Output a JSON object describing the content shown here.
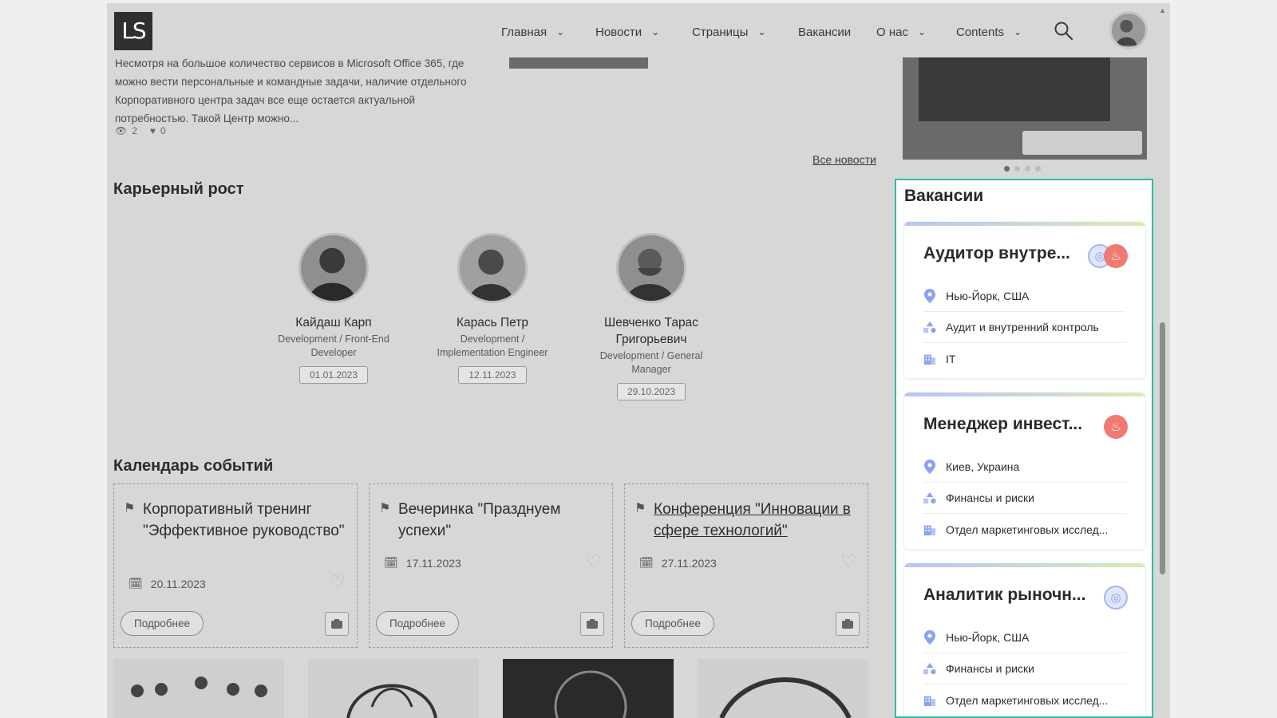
{
  "header": {
    "logo": "LS",
    "nav": [
      {
        "label": "Главная",
        "dropdown": true
      },
      {
        "label": "Новости",
        "dropdown": true
      },
      {
        "label": "Страницы",
        "dropdown": true
      },
      {
        "label": "Вакансии",
        "dropdown": false
      },
      {
        "label": "О нас",
        "dropdown": true
      },
      {
        "label": "Contents",
        "dropdown": true
      }
    ],
    "search_icon": "search-icon",
    "avatar_icon": "user-avatar"
  },
  "news": {
    "excerpt": "Несмотря на большое количество сервисов в Microsoft Office 365, где можно вести персональные и командные задачи, наличие отдельного Корпоративного центра задач все еще остается актуальной потребностью. Такой Центр можно...",
    "views": "2",
    "likes": "0",
    "all_news_link": "Все новости"
  },
  "career": {
    "title": "Карьерный рост",
    "people": [
      {
        "name": "Кайдаш Карп",
        "role": "Development / Front-End Developer",
        "date": "01.01.2023"
      },
      {
        "name": "Карась Петр",
        "role": "Development / Implementation Engineer",
        "date": "12.11.2023"
      },
      {
        "name": "Шевченко Тарас Григорьевич",
        "role": "Development / General Manager",
        "date": "29.10.2023"
      }
    ]
  },
  "events": {
    "title": "Календарь событий",
    "items": [
      {
        "title": "Корпоративный тренинг \"Эффективное руководство\"",
        "date": "20.11.2023",
        "more": "Подробнее"
      },
      {
        "title": "Вечеринка \"Празднуем успехи\"",
        "date": "17.11.2023",
        "more": "Подробнее"
      },
      {
        "title": "Конференция \"Инновации в сфере технологий\"",
        "date": "27.11.2023",
        "more": "Подробнее"
      }
    ]
  },
  "vacancies": {
    "title": "Вакансии",
    "items": [
      {
        "title": "Аудитор внутре...",
        "location": "Нью-Йорк, США",
        "category": "Аудит и внутренний контроль",
        "department": "IT",
        "badges": [
          "target",
          "hot"
        ]
      },
      {
        "title": "Менеджер инвест...",
        "location": "Киев, Украина",
        "category": "Финансы и риски",
        "department": "Отдел маркетинговых исслед...",
        "badges": [
          "hot"
        ]
      },
      {
        "title": "Аналитик рыночн...",
        "location": "Нью-Йорк, США",
        "category": "Финансы и риски",
        "department": "Отдел маркетинговых исслед...",
        "badges": [
          "target"
        ]
      }
    ]
  },
  "colors": {
    "highlight_border": "#2cbfa6",
    "hot_badge": "#f07a72",
    "target_badge": "#8a9ff0",
    "location_icon": "#8aa3f2",
    "overlay": "#d7d7d7"
  }
}
